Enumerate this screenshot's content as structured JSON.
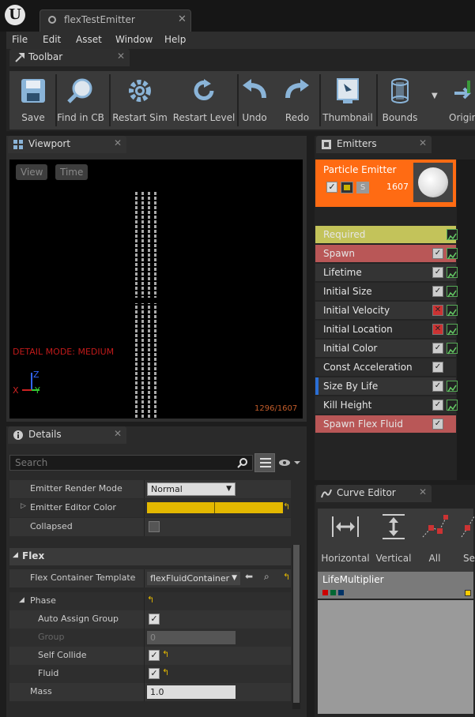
{
  "document_tab": {
    "title": "flexTestEmitter"
  },
  "menu": [
    "File",
    "Edit",
    "Asset",
    "Window",
    "Help"
  ],
  "toolbar": {
    "title": "Toolbar",
    "buttons": [
      {
        "label": "Save",
        "icon": "save-icon"
      },
      {
        "label": "Find in CB",
        "icon": "magnifier-icon"
      },
      {
        "label": "Restart Sim",
        "icon": "gear-icon"
      },
      {
        "label": "Restart Level",
        "icon": "refresh-icon"
      },
      {
        "label": "Undo",
        "icon": "undo-icon"
      },
      {
        "label": "Redo",
        "icon": "redo-icon"
      },
      {
        "label": "Thumbnail",
        "icon": "thumbnail-icon"
      },
      {
        "label": "Bounds",
        "icon": "bounds-icon"
      },
      {
        "label": "Origin",
        "icon": "origin-icon"
      }
    ]
  },
  "viewport": {
    "title": "Viewport",
    "view_btn": "View",
    "time_btn": "Time",
    "detail_mode": "DETAIL MODE: MEDIUM",
    "particle_count": "1296/1607",
    "axis_x": "X",
    "axis_y": "Y",
    "axis_z": "Z"
  },
  "details": {
    "title": "Details",
    "search_placeholder": "Search",
    "rows": {
      "render_mode_label": "Emitter Render Mode",
      "render_mode_value": "Normal",
      "editor_color_label": "Emitter Editor Color",
      "collapsed_label": "Collapsed",
      "section": "Flex",
      "container_label": "Flex Container Template",
      "container_value": "flexFluidContainer",
      "phase_label": "Phase",
      "auto_assign_label": "Auto Assign Group",
      "group_label": "Group",
      "group_value": "0",
      "self_collide_label": "Self Collide",
      "fluid_label": "Fluid",
      "mass_label": "Mass",
      "mass_value": "1.0"
    }
  },
  "emitters": {
    "title": "Emitters",
    "header": {
      "name": "Particle Emitter",
      "count": "1607",
      "solo": "S"
    },
    "modules": [
      {
        "label": "Required",
        "bg": "#c3c35a",
        "check": null,
        "curve": true
      },
      {
        "label": "Spawn",
        "bg": "#b95757",
        "check": "on",
        "curve": true
      },
      {
        "label": "Lifetime",
        "bg": "#343434",
        "check": "on",
        "curve": true
      },
      {
        "label": "Initial Size",
        "bg": "#2c2c2c",
        "check": "on",
        "curve": true
      },
      {
        "label": "Initial Velocity",
        "bg": "#343434",
        "check": "off",
        "curve": true
      },
      {
        "label": "Initial Location",
        "bg": "#2c2c2c",
        "check": "off",
        "curve": true
      },
      {
        "label": "Initial Color",
        "bg": "#343434",
        "check": "on",
        "curve": true
      },
      {
        "label": "Const Acceleration",
        "bg": "#2c2c2c",
        "check": "on",
        "curve": false
      },
      {
        "label": "Size By Life",
        "bg": "#343434",
        "check": "on",
        "curve": true
      },
      {
        "label": "Kill Height",
        "bg": "#2c2c2c",
        "check": "on",
        "curve": true
      },
      {
        "label": "Spawn Flex Fluid",
        "bg": "#b95757",
        "check": "on",
        "curve": false
      }
    ]
  },
  "curve_editor": {
    "title": "Curve Editor",
    "buttons": [
      "Horizontal",
      "Vertical",
      "All",
      "Sel"
    ],
    "curve_name": "LifeMultiplier"
  }
}
